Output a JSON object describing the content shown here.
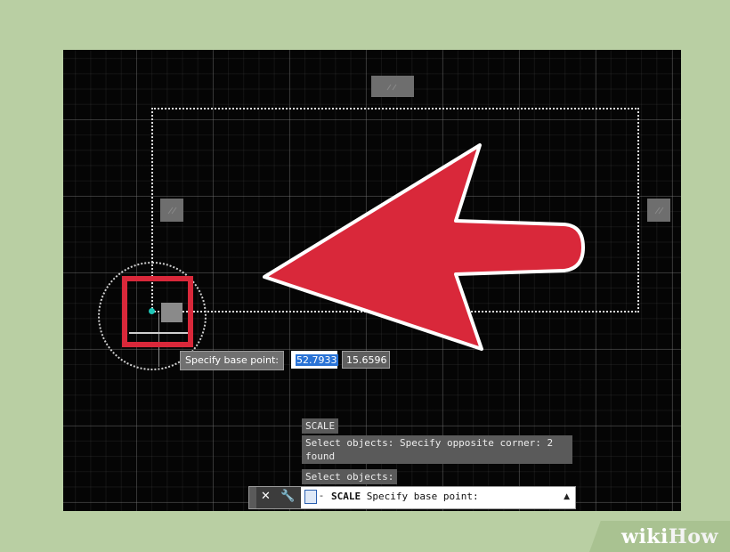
{
  "tooltip": {
    "label": "Specify base point:",
    "x_value": "52.7933",
    "y_value": "15.6596"
  },
  "history": {
    "line1": "SCALE",
    "line2": "Select objects: Specify opposite corner: 2 found",
    "line3": "Select objects:"
  },
  "commandline": {
    "close_glyph": "✕",
    "customize_glyph": "🔧",
    "command": "SCALE",
    "prompt": " Specify base point:",
    "dash": "-",
    "scroll_glyph": "▲"
  },
  "watermark": {
    "wiki": "wiki",
    "how": "How"
  },
  "colors": {
    "accent_red": "#d9283a",
    "background_green": "#b9cfa3",
    "canvas": "#050505",
    "base_point": "#1fc7b8"
  }
}
